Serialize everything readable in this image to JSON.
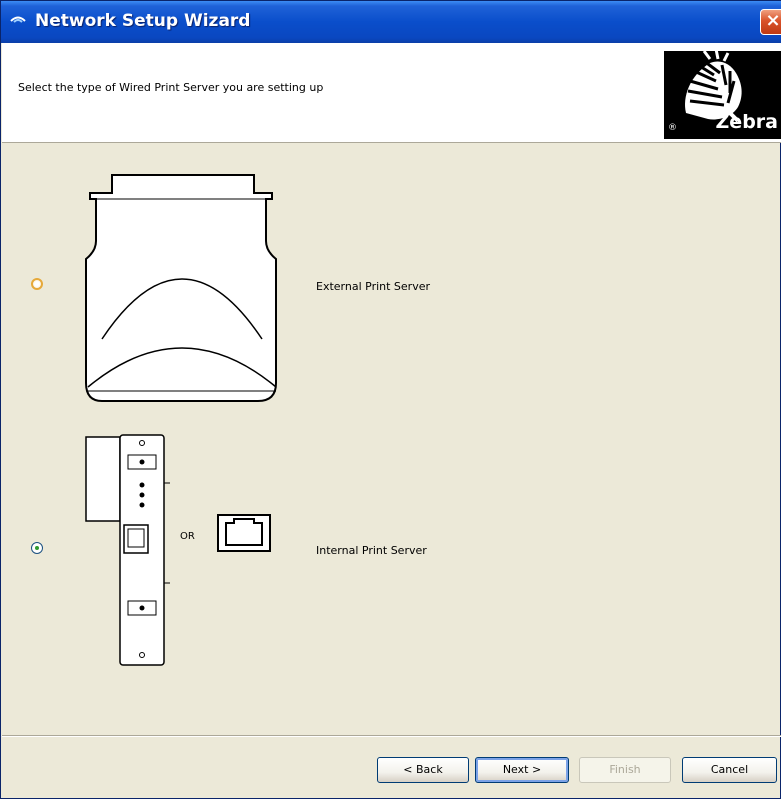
{
  "window": {
    "title": "Network Setup Wizard",
    "close_label": "×"
  },
  "header": {
    "instruction": "Select the type of Wired Print Server you are setting up",
    "logo": {
      "name": "Zebra",
      "reg": "®"
    }
  },
  "options": [
    {
      "label": "External Print Server",
      "selected": false
    },
    {
      "label": "Internal Print Server",
      "selected": true
    }
  ],
  "or_text": "OR",
  "buttons": {
    "back": "< Back",
    "next": "Next >",
    "finish": "Finish",
    "cancel": "Cancel"
  },
  "colors": {
    "titlebar": "#0a4ecb",
    "dialog_bg": "#ece9d8",
    "radio_hover": "#e6a93a",
    "radio_selected_dot": "#2f9a2f"
  }
}
